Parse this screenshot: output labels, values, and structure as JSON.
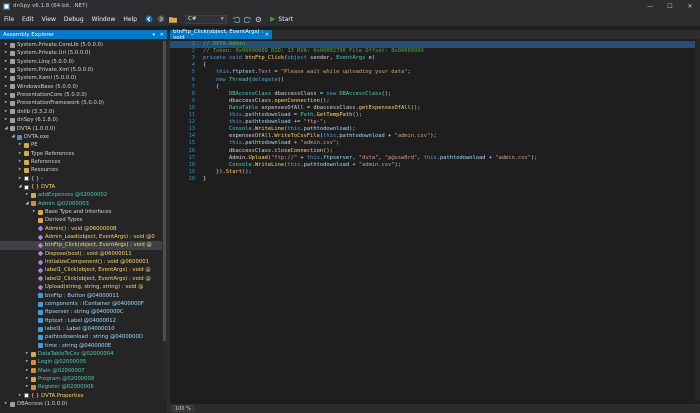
{
  "window": {
    "title": "dnSpy v6.1.8 (64-bit, .NET)",
    "min": "—",
    "max": "☐",
    "close": "✕"
  },
  "menu": [
    "File",
    "Edit",
    "View",
    "Debug",
    "Window",
    "Help"
  ],
  "toolbar": {
    "language": "C#",
    "start_label": "Start"
  },
  "explorer": {
    "title": "Assembly Explorer",
    "nodes": [
      {
        "depth": 0,
        "exp": "▸",
        "ico": "i-asm",
        "cls": "c-dim",
        "label": "System.Private.CoreLib (5.0.0.0)"
      },
      {
        "depth": 0,
        "exp": "▸",
        "ico": "i-asm",
        "cls": "c-dim",
        "label": "System.Private.Uri (5.0.0.0)"
      },
      {
        "depth": 0,
        "exp": "▸",
        "ico": "i-asm",
        "cls": "c-dim",
        "label": "System.Linq (5.0.0.0)"
      },
      {
        "depth": 0,
        "exp": "▸",
        "ico": "i-asm",
        "cls": "c-dim",
        "label": "System.Private.Xml (5.0.0.0)"
      },
      {
        "depth": 0,
        "exp": "▸",
        "ico": "i-asm",
        "cls": "c-dim",
        "label": "System.Xaml (5.0.0.0)"
      },
      {
        "depth": 0,
        "exp": "▸",
        "ico": "i-asm",
        "cls": "c-dim",
        "label": "WindowsBase (5.0.0.0)"
      },
      {
        "depth": 0,
        "exp": "▸",
        "ico": "i-asm",
        "cls": "c-dim",
        "label": "PresentationCore (5.0.0.0)"
      },
      {
        "depth": 0,
        "exp": "▸",
        "ico": "i-asm",
        "cls": "c-dim",
        "label": "PresentationFramework (5.0.0.0)"
      },
      {
        "depth": 0,
        "exp": "▸",
        "ico": "i-asm",
        "cls": "c-dim",
        "label": "dnlib (3.3.2.0)"
      },
      {
        "depth": 0,
        "exp": "▸",
        "ico": "i-asm",
        "cls": "c-dim",
        "label": "dnSpy (6.1.8.0)"
      },
      {
        "depth": 0,
        "exp": "◢",
        "ico": "i-asm",
        "cls": "c-dim",
        "label": "DVTA (1.0.0.0)"
      },
      {
        "depth": 1,
        "exp": "◢",
        "ico": "i-mod",
        "cls": "c-dim",
        "label": "DVTA.exe"
      },
      {
        "depth": 2,
        "exp": "▸",
        "ico": "i-folder",
        "cls": "c-dim",
        "label": "PE"
      },
      {
        "depth": 2,
        "exp": "▸",
        "ico": "i-folder",
        "cls": "c-dim",
        "label": "Type References"
      },
      {
        "depth": 2,
        "exp": "▸",
        "ico": "i-folder",
        "cls": "c-dim",
        "label": "References"
      },
      {
        "depth": 2,
        "exp": "▸",
        "ico": "i-folder",
        "cls": "c-dim",
        "label": "Resources"
      },
      {
        "depth": 2,
        "exp": "▸",
        "ico": "i-ns",
        "cls": "c-dim",
        "label": "{ } -"
      },
      {
        "depth": 2,
        "exp": "◢",
        "ico": "i-ns",
        "cls": "c-ns",
        "label": "{ } DVTA"
      },
      {
        "depth": 3,
        "exp": "▸",
        "ico": "i-cls",
        "cls": "c-type",
        "label": "addExpenses @02000002"
      },
      {
        "depth": 3,
        "exp": "◢",
        "ico": "i-form",
        "cls": "c-type",
        "label": "Admin @02000003"
      },
      {
        "depth": 4,
        "exp": "▸",
        "ico": "i-folder",
        "cls": "c-dim",
        "label": "Base Type and Interfaces"
      },
      {
        "depth": 4,
        "exp": "",
        "ico": "i-folder",
        "cls": "c-dim",
        "label": "Derived Types"
      },
      {
        "depth": 4,
        "exp": "",
        "ico": "i-method",
        "cls": "c-method",
        "label": "Admin() : void @0600000B"
      },
      {
        "depth": 4,
        "exp": "",
        "ico": "i-method",
        "cls": "c-method",
        "label": "Admin_Load(object, EventArgs) : void @0"
      },
      {
        "depth": 4,
        "exp": "",
        "ico": "i-method",
        "cls": "c-method",
        "label": "btnFtp_Click(object, EventArgs) : void @",
        "selected": true
      },
      {
        "depth": 4,
        "exp": "",
        "ico": "i-method",
        "cls": "c-method",
        "label": "Dispose(bool) : void @06000011"
      },
      {
        "depth": 4,
        "exp": "",
        "ico": "i-method",
        "cls": "c-method",
        "label": "InitializeComponent() : void @0600001"
      },
      {
        "depth": 4,
        "exp": "",
        "ico": "i-method",
        "cls": "c-method",
        "label": "label1_Click(object, EventArgs) : void @"
      },
      {
        "depth": 4,
        "exp": "",
        "ico": "i-method",
        "cls": "c-method",
        "label": "label2_Click(object, EventArgs) : void @"
      },
      {
        "depth": 4,
        "exp": "",
        "ico": "i-method",
        "cls": "c-method",
        "label": "Upload(string, string, string) : void @"
      },
      {
        "depth": 4,
        "exp": "",
        "ico": "i-field",
        "cls": "c-field",
        "label": "btnFtp : Button @04000011"
      },
      {
        "depth": 4,
        "exp": "",
        "ico": "i-field",
        "cls": "c-field",
        "label": "components : IContainer @0400000F"
      },
      {
        "depth": 4,
        "exp": "",
        "ico": "i-field",
        "cls": "c-field",
        "label": "ftpserver : string @0400000C"
      },
      {
        "depth": 4,
        "exp": "",
        "ico": "i-field",
        "cls": "c-field",
        "label": "ftptext : Label @04000012"
      },
      {
        "depth": 4,
        "exp": "",
        "ico": "i-field",
        "cls": "c-field",
        "label": "label1 : Label @04000010"
      },
      {
        "depth": 4,
        "exp": "",
        "ico": "i-field",
        "cls": "c-field",
        "label": "pathtodownload : string @0400000D"
      },
      {
        "depth": 4,
        "exp": "",
        "ico": "i-field",
        "cls": "c-field",
        "label": "time : string @0400000E"
      },
      {
        "depth": 3,
        "exp": "▸",
        "ico": "i-cls",
        "cls": "c-type",
        "label": "DataTableToCsv @02000004"
      },
      {
        "depth": 3,
        "exp": "▸",
        "ico": "i-form",
        "cls": "c-type",
        "label": "Login @02000005"
      },
      {
        "depth": 3,
        "exp": "▸",
        "ico": "i-form",
        "cls": "c-type",
        "label": "Main @02000007"
      },
      {
        "depth": 3,
        "exp": "▸",
        "ico": "i-cls",
        "cls": "c-type",
        "label": "Program @02000008"
      },
      {
        "depth": 3,
        "exp": "▸",
        "ico": "i-form",
        "cls": "c-type",
        "label": "Register @02000006"
      },
      {
        "depth": 2,
        "exp": "▸",
        "ico": "i-ns",
        "cls": "c-ns",
        "label": "{ } DVTA.Properties"
      },
      {
        "depth": 0,
        "exp": "▸",
        "ico": "i-asm",
        "cls": "c-dim",
        "label": "DBAccess (1.0.0.0)"
      }
    ]
  },
  "editor": {
    "tab_label": "btnFtp_Click(object, EventArgs) : void",
    "zoom": "100 %",
    "lines": [
      {
        "n": "1",
        "hl": true,
        "segs": [
          [
            "cm",
            "// DVTA.Admin"
          ]
        ]
      },
      {
        "n": "2",
        "segs": [
          [
            "cm",
            "// Token: 0x0600000D RID: 13 RVA: 0x00002790 File Offset: 0x00000990"
          ]
        ]
      },
      {
        "n": "3",
        "segs": [
          [
            "k",
            "private void "
          ],
          [
            "m",
            "btnFtp_Click"
          ],
          [
            "p",
            "("
          ],
          [
            "k",
            "object"
          ],
          [
            "p",
            " sender, "
          ],
          [
            "t",
            "EventArgs"
          ],
          [
            "p",
            " e)"
          ]
        ]
      },
      {
        "n": "4",
        "segs": [
          [
            "p",
            "{"
          ]
        ]
      },
      {
        "n": "5",
        "segs": [
          [
            "p",
            "    "
          ],
          [
            "k",
            "this"
          ],
          [
            "p",
            "."
          ],
          [
            "f",
            "ftptext"
          ],
          [
            "p",
            "."
          ],
          [
            "pr",
            "Text"
          ],
          [
            "p",
            " = "
          ],
          [
            "s",
            "\"Please wait while uploading your data\""
          ],
          [
            "p",
            ";"
          ]
        ]
      },
      {
        "n": "6",
        "segs": [
          [
            "p",
            "    "
          ],
          [
            "k",
            "new "
          ],
          [
            "t",
            "Thread"
          ],
          [
            "p",
            "("
          ],
          [
            "k",
            "delegate"
          ],
          [
            "p",
            "()"
          ]
        ]
      },
      {
        "n": "7",
        "segs": [
          [
            "p",
            "    {"
          ]
        ]
      },
      {
        "n": "8",
        "segs": [
          [
            "p",
            "        "
          ],
          [
            "t",
            "DBAccessClass"
          ],
          [
            "p",
            " dbaccessClass = "
          ],
          [
            "k",
            "new "
          ],
          [
            "t",
            "DBAccessClass"
          ],
          [
            "p",
            "();"
          ]
        ]
      },
      {
        "n": "9",
        "segs": [
          [
            "p",
            "        dbaccessClass."
          ],
          [
            "m",
            "openConnection"
          ],
          [
            "p",
            "();"
          ]
        ]
      },
      {
        "n": "10",
        "segs": [
          [
            "p",
            "        "
          ],
          [
            "t",
            "DataTable"
          ],
          [
            "p",
            " expensesOfAll = dbaccessClass."
          ],
          [
            "m",
            "getExpensesOfAll"
          ],
          [
            "p",
            "();"
          ]
        ]
      },
      {
        "n": "11",
        "segs": [
          [
            "p",
            "        "
          ],
          [
            "k",
            "this"
          ],
          [
            "p",
            "."
          ],
          [
            "f",
            "pathtodownload"
          ],
          [
            "p",
            " = "
          ],
          [
            "t",
            "Path"
          ],
          [
            "p",
            "."
          ],
          [
            "m",
            "GetTempPath"
          ],
          [
            "p",
            "();"
          ]
        ]
      },
      {
        "n": "12",
        "segs": [
          [
            "p",
            "        "
          ],
          [
            "k",
            "this"
          ],
          [
            "p",
            "."
          ],
          [
            "f",
            "pathtodownload"
          ],
          [
            "p",
            " += "
          ],
          [
            "s",
            "\"ftp-\""
          ],
          [
            "p",
            ";"
          ]
        ]
      },
      {
        "n": "13",
        "segs": [
          [
            "p",
            "        "
          ],
          [
            "t",
            "Console"
          ],
          [
            "p",
            "."
          ],
          [
            "m",
            "WriteLine"
          ],
          [
            "p",
            "("
          ],
          [
            "k",
            "this"
          ],
          [
            "p",
            "."
          ],
          [
            "f",
            "pathtodownload"
          ],
          [
            "p",
            ");"
          ]
        ]
      },
      {
        "n": "14",
        "segs": [
          [
            "p",
            "        expensesOfAll."
          ],
          [
            "m",
            "WriteToCsvFile"
          ],
          [
            "p",
            "("
          ],
          [
            "k",
            "this"
          ],
          [
            "p",
            "."
          ],
          [
            "f",
            "pathtodownload"
          ],
          [
            "p",
            " + "
          ],
          [
            "s",
            "\"admin.csv\""
          ],
          [
            "p",
            ");"
          ]
        ]
      },
      {
        "n": "15",
        "segs": [
          [
            "p",
            "        "
          ],
          [
            "k",
            "this"
          ],
          [
            "p",
            "."
          ],
          [
            "f",
            "pathtodownload"
          ],
          [
            "p",
            " + "
          ],
          [
            "s",
            "\"admin.csv\""
          ],
          [
            "p",
            ";"
          ]
        ]
      },
      {
        "n": "16",
        "segs": [
          [
            "p",
            "        dbaccessClass."
          ],
          [
            "m",
            "closeConnection"
          ],
          [
            "p",
            "();"
          ]
        ]
      },
      {
        "n": "17",
        "segs": [
          [
            "p",
            "        Admin."
          ],
          [
            "m",
            "Upload"
          ],
          [
            "p",
            "("
          ],
          [
            "s",
            "\"ftp://\""
          ],
          [
            "p",
            " + "
          ],
          [
            "k",
            "this"
          ],
          [
            "p",
            "."
          ],
          [
            "f",
            "ftpserver"
          ],
          [
            "p",
            ", "
          ],
          [
            "s",
            "\"dvta\""
          ],
          [
            "p",
            ", "
          ],
          [
            "s",
            "\"p@ssw0rd\""
          ],
          [
            "p",
            ", "
          ],
          [
            "k",
            "this"
          ],
          [
            "p",
            "."
          ],
          [
            "f",
            "pathtodownload"
          ],
          [
            "p",
            " + "
          ],
          [
            "s",
            "\"admin.csv\""
          ],
          [
            "p",
            ");"
          ]
        ]
      },
      {
        "n": "18",
        "segs": [
          [
            "p",
            "        "
          ],
          [
            "t",
            "Console"
          ],
          [
            "p",
            "."
          ],
          [
            "m",
            "WriteLine"
          ],
          [
            "p",
            "("
          ],
          [
            "k",
            "this"
          ],
          [
            "p",
            "."
          ],
          [
            "f",
            "pathtodownload"
          ],
          [
            "p",
            " + "
          ],
          [
            "s",
            "\"admin.csv\""
          ],
          [
            "p",
            ");"
          ]
        ]
      },
      {
        "n": "19",
        "segs": [
          [
            "p",
            "    })."
          ],
          [
            "m",
            "Start"
          ],
          [
            "p",
            "();"
          ]
        ]
      },
      {
        "n": "20",
        "segs": [
          [
            "p",
            "}"
          ]
        ]
      }
    ]
  },
  "colors": {
    "accent": "#007acc",
    "selection": "#3f3f46",
    "background": "#1e1e1e"
  }
}
